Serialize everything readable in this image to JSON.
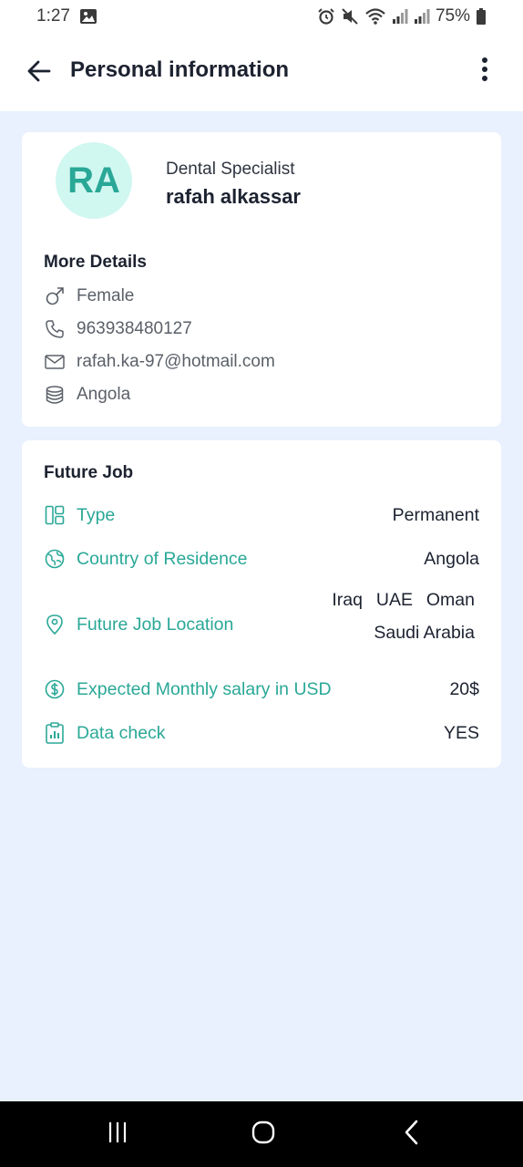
{
  "status_bar": {
    "time": "1:27",
    "battery_percent": "75%",
    "icons": [
      "image-icon",
      "alarm-icon",
      "mute-icon",
      "wifi-icon",
      "signal-icon",
      "signal-icon",
      "battery-icon"
    ]
  },
  "app_bar": {
    "title": "Personal information",
    "back_icon": "arrow-left-icon",
    "menu_icon": "more-vertical-icon"
  },
  "profile": {
    "initials": "RA",
    "profession": "Dental Specialist",
    "name": "rafah alkassar",
    "details_title": "More Details",
    "details": [
      {
        "icon": "male-icon",
        "value": "Female"
      },
      {
        "icon": "phone-icon",
        "value": "963938480127"
      },
      {
        "icon": "mail-icon",
        "value": "rafah.ka-97@hotmail.com"
      },
      {
        "icon": "coins-icon",
        "value": "Angola"
      }
    ]
  },
  "future_job": {
    "title": "Future Job",
    "type": {
      "label": "Type",
      "value": "Permanent",
      "icon": "layout-icon"
    },
    "country": {
      "label": "Country of Residence",
      "value": "Angola",
      "icon": "globe-icon"
    },
    "location": {
      "label": "Future Job Location",
      "values": [
        "Iraq",
        "UAE",
        "Oman",
        "Saudi Arabia"
      ],
      "icon": "map-pin-icon"
    },
    "salary": {
      "label": "Expected Monthly salary in USD",
      "value": "20$",
      "icon": "dollar-circle-icon"
    },
    "data_check": {
      "label": "Data check",
      "value": "YES",
      "icon": "clipboard-chart-icon"
    }
  },
  "colors": {
    "accent": "#2aa897",
    "background": "#e8f1fd",
    "avatar_bg": "#d1f7f1"
  },
  "nav_bar": {
    "buttons": [
      "recents-icon",
      "home-icon",
      "back-icon"
    ]
  }
}
